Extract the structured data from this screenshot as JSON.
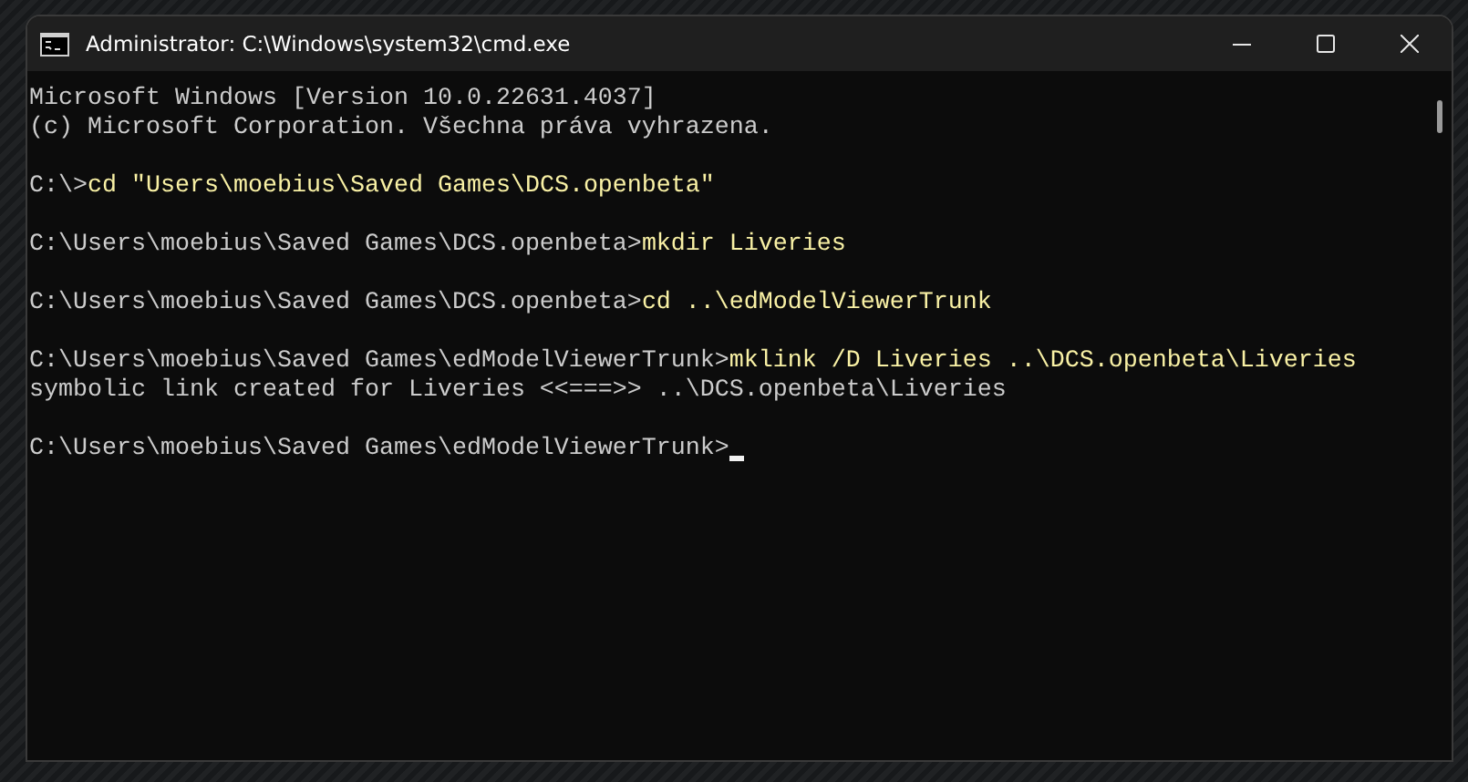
{
  "window": {
    "title": "Administrator: C:\\Windows\\system32\\cmd.exe"
  },
  "console": [
    {
      "kind": "output",
      "text": "Microsoft Windows [Version 10.0.22631.4037]"
    },
    {
      "kind": "output",
      "text": "(c) Microsoft Corporation. Všechna práva vyhrazena."
    },
    {
      "kind": "blank"
    },
    {
      "kind": "command",
      "prompt": "C:\\>",
      "command": "cd \"Users\\moebius\\Saved Games\\DCS.openbeta\""
    },
    {
      "kind": "blank"
    },
    {
      "kind": "command",
      "prompt": "C:\\Users\\moebius\\Saved Games\\DCS.openbeta>",
      "command": "mkdir Liveries"
    },
    {
      "kind": "blank"
    },
    {
      "kind": "command",
      "prompt": "C:\\Users\\moebius\\Saved Games\\DCS.openbeta>",
      "command": "cd ..\\edModelViewerTrunk"
    },
    {
      "kind": "blank"
    },
    {
      "kind": "command",
      "prompt": "C:\\Users\\moebius\\Saved Games\\edModelViewerTrunk>",
      "command": "mklink /D Liveries ..\\DCS.openbeta\\Liveries"
    },
    {
      "kind": "output",
      "text": "symbolic link created for Liveries <<===>> ..\\DCS.openbeta\\Liveries"
    },
    {
      "kind": "blank"
    },
    {
      "kind": "cursor",
      "prompt": "C:\\Users\\moebius\\Saved Games\\edModelViewerTrunk>"
    }
  ]
}
